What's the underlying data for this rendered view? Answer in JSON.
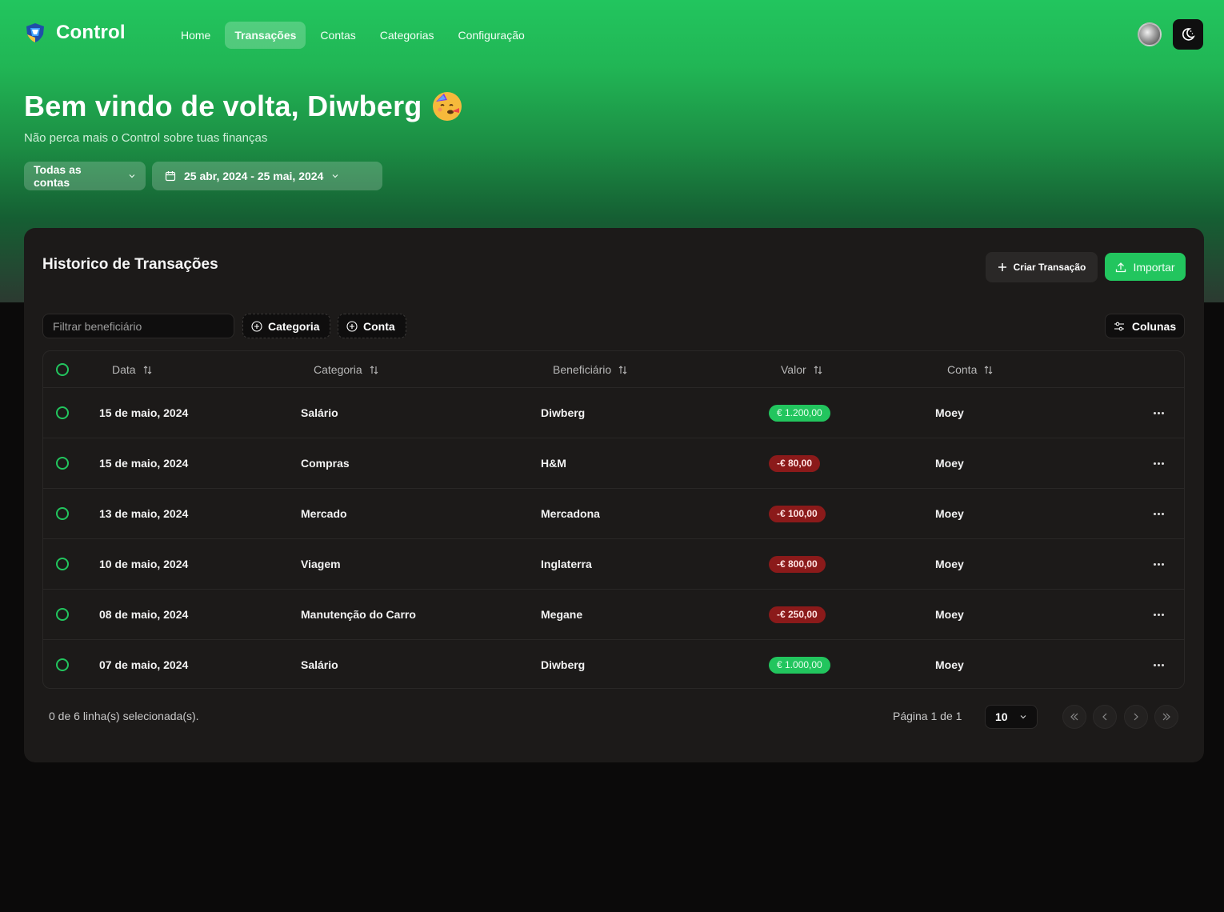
{
  "brand": {
    "name": "Control",
    "logo_icon": "control-logo-icon"
  },
  "nav": [
    {
      "label": "Home",
      "active": false
    },
    {
      "label": "Transações",
      "active": true
    },
    {
      "label": "Contas",
      "active": false
    },
    {
      "label": "Categorias",
      "active": false
    },
    {
      "label": "Configuração",
      "active": false
    }
  ],
  "header": {
    "user_avatar_icon": "user-avatar",
    "theme_toggle_icon": "moon-icon"
  },
  "welcome": {
    "title": "Bem vindo de volta, Diwberg",
    "emoji_icon": "partying-face-emoji",
    "subtitle": "Não perca mais o Control sobre tuas finanças"
  },
  "filters": {
    "accounts_label": "Todas as contas",
    "date_range_label": "25 abr, 2024 - 25 mai, 2024"
  },
  "card": {
    "title": "Historico de Transações",
    "create_label": "Criar Transação",
    "import_label": "Importar",
    "search_placeholder": "Filtrar beneficiário",
    "facet_category": "Categoria",
    "facet_account": "Conta",
    "columns_label": "Colunas"
  },
  "table": {
    "headers": [
      "Data",
      "Categoria",
      "Beneficiário",
      "Valor",
      "Conta"
    ],
    "rows": [
      {
        "date": "15 de maio, 2024",
        "category": "Salário",
        "payee": "Diwberg",
        "amount": "€ 1.200,00",
        "type": "income",
        "account": "Moey"
      },
      {
        "date": "15 de maio, 2024",
        "category": "Compras",
        "payee": "H&M",
        "amount": "-€ 80,00",
        "type": "expense",
        "account": "Moey"
      },
      {
        "date": "13 de maio, 2024",
        "category": "Mercado",
        "payee": "Mercadona",
        "amount": "-€ 100,00",
        "type": "expense",
        "account": "Moey"
      },
      {
        "date": "10 de maio, 2024",
        "category": "Viagem",
        "payee": "Inglaterra",
        "amount": "-€ 800,00",
        "type": "expense",
        "account": "Moey"
      },
      {
        "date": "08 de maio, 2024",
        "category": "Manutenção do Carro",
        "payee": "Megane",
        "amount": "-€ 250,00",
        "type": "expense",
        "account": "Moey"
      },
      {
        "date": "07 de maio, 2024",
        "category": "Salário",
        "payee": "Diwberg",
        "amount": "€ 1.000,00",
        "type": "income",
        "account": "Moey"
      }
    ]
  },
  "footer": {
    "selected_text": "0 de 6 linha(s) selecionada(s).",
    "page_text": "Página 1 de 1",
    "page_size": "10"
  },
  "colors": {
    "accent": "#22c55e",
    "expense": "#8b1a1a",
    "card_bg": "#1c1a19",
    "page_bg": "#0b0a0a"
  }
}
